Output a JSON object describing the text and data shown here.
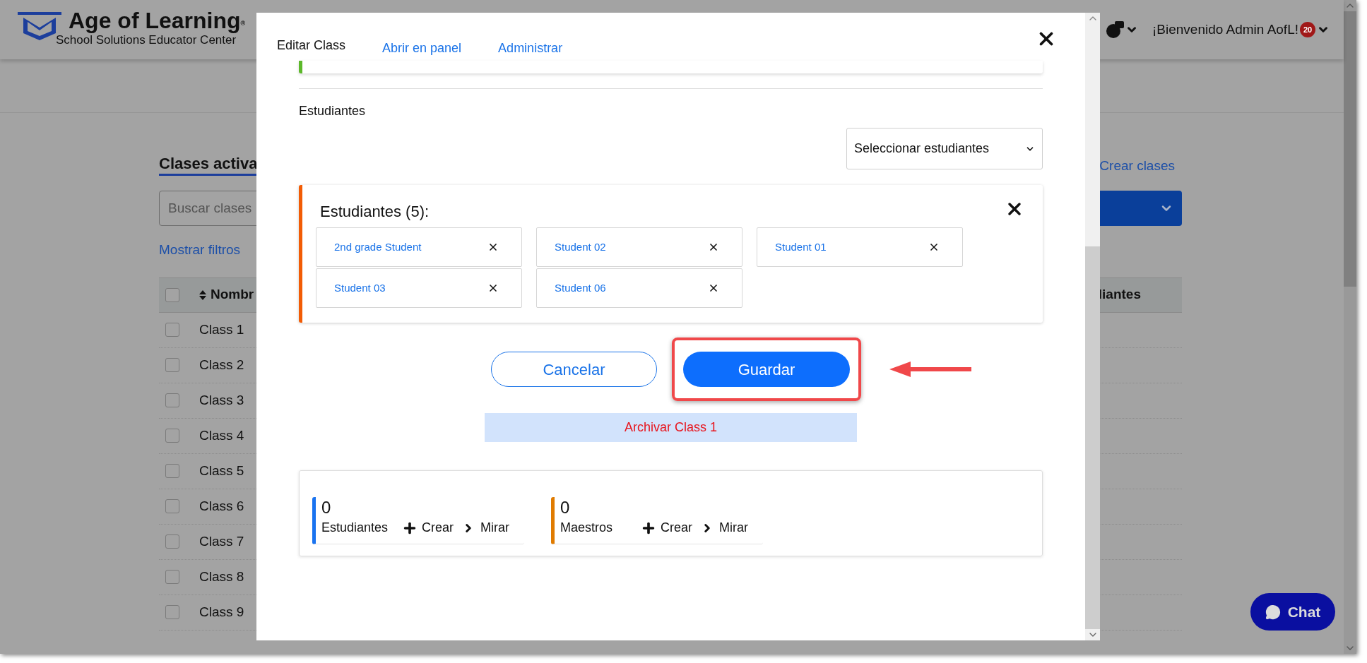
{
  "header": {
    "brand": "Age of Learning",
    "brand_mark": "®",
    "subtitle": "School Solutions Educator Center",
    "welcome": "¡Bienvenido Admin AofL!",
    "notification_count": "20"
  },
  "page": {
    "title": "Clases activa",
    "search": {
      "placeholder": "Buscar clases"
    },
    "filters_link": "Mostrar filtros",
    "create_link": "Crear clases",
    "table": {
      "select_all": {
        "checked": false
      },
      "columns": [
        "Nombr",
        "liantes"
      ],
      "rows": [
        {
          "name": "Class 1",
          "checked": false
        },
        {
          "name": "Class 2",
          "checked": false
        },
        {
          "name": "Class 3",
          "checked": false
        },
        {
          "name": "Class 4",
          "checked": false
        },
        {
          "name": "Class 5",
          "checked": false
        },
        {
          "name": "Class 6",
          "checked": false
        },
        {
          "name": "Class 7",
          "checked": false
        },
        {
          "name": "Class 8",
          "checked": false
        },
        {
          "name": "Class 9",
          "checked": false
        }
      ]
    }
  },
  "chat": {
    "label": "Chat"
  },
  "modal": {
    "tabs": [
      {
        "label": "Editar Class",
        "selected": true
      },
      {
        "label": "Abrir en panel",
        "selected": false
      },
      {
        "label": "Administrar",
        "selected": false
      }
    ],
    "students_label": "Estudiantes",
    "select": {
      "value": "Seleccionar estudiantes"
    },
    "selected_students": {
      "title": "Estudiantes (5):",
      "items": [
        "2nd grade Student",
        "Student 02",
        "Student 01",
        "Student 03",
        "Student 06"
      ]
    },
    "buttons": {
      "cancel": "Cancelar",
      "save": "Guardar"
    },
    "archive": "Archivar Class 1",
    "stats": [
      {
        "count": "0",
        "label": "Estudiantes",
        "create": "Crear",
        "view": "Mirar",
        "color": "#1a73f0"
      },
      {
        "count": "0",
        "label": "Maestros",
        "create": "Crear",
        "view": "Mirar",
        "color": "#e07b00"
      }
    ]
  }
}
